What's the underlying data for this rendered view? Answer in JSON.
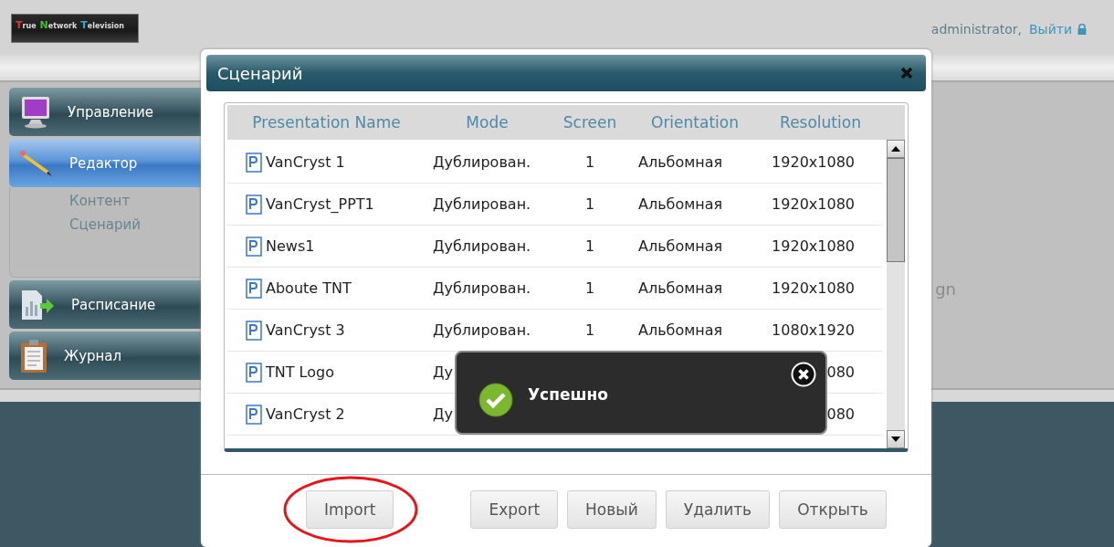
{
  "logo": {
    "words": [
      {
        "text": "True",
        "color": "#e0392b"
      },
      {
        "text": "Network",
        "color": "#3fbf2f"
      },
      {
        "text": "Television",
        "color": "#2fa8d8"
      }
    ]
  },
  "user": {
    "name": "administrator,",
    "logout": "Выйти"
  },
  "sidebar": {
    "items": [
      {
        "kind": "monitor",
        "label": "Управление",
        "selected": false
      },
      {
        "kind": "pencil",
        "label": "Редактор",
        "selected": true,
        "expanded": true,
        "children": [
          {
            "label": "Контент"
          },
          {
            "label": "Сценарий"
          }
        ]
      },
      {
        "kind": "chart",
        "label": "Расписание",
        "selected": false
      },
      {
        "kind": "clipboard",
        "label": "Журнал",
        "selected": false
      }
    ]
  },
  "background_text": "gn",
  "dialog": {
    "title": "Сценарий",
    "table": {
      "columns": [
        "Presentation Name",
        "Mode",
        "Screen",
        "Orientation",
        "Resolution"
      ],
      "rows": [
        {
          "name": "VanCryst 1",
          "mode": "Дублирован.",
          "screen": "1",
          "orientation": "Альбомная",
          "resolution": "1920x1080"
        },
        {
          "name": "VanCryst_PPT1",
          "mode": "Дублирован.",
          "screen": "1",
          "orientation": "Альбомная",
          "resolution": "1920x1080"
        },
        {
          "name": "News1",
          "mode": "Дублирован.",
          "screen": "1",
          "orientation": "Альбомная",
          "resolution": "1920x1080"
        },
        {
          "name": "Aboute TNT",
          "mode": "Дублирован.",
          "screen": "1",
          "orientation": "Альбомная",
          "resolution": "1920x1080"
        },
        {
          "name": "VanCryst 3",
          "mode": "Дублирован.",
          "screen": "1",
          "orientation": "Альбомная",
          "resolution": "1080x1920"
        },
        {
          "name": "TNT Logo",
          "mode": "Ду",
          "resolution": "080"
        },
        {
          "name": "VanCryst 2",
          "mode": "Ду",
          "resolution": "080"
        }
      ]
    },
    "buttons": [
      {
        "label": "Import",
        "highlighted": true
      },
      {
        "label": "Export",
        "highlighted": false
      },
      {
        "label": "Новый",
        "highlighted": false
      },
      {
        "label": "Удалить",
        "highlighted": false
      },
      {
        "label": "Открыть",
        "highlighted": false
      }
    ]
  },
  "toast": {
    "message": "Успешно"
  }
}
